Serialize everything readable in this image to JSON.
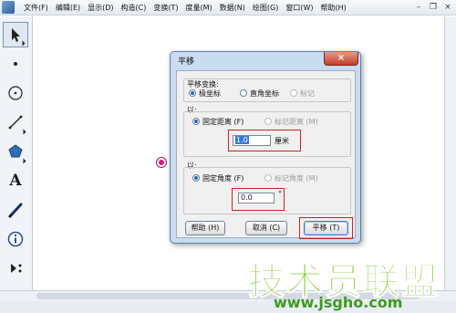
{
  "menubar": {
    "items": [
      "文件(F)",
      "编辑(E)",
      "显示(D)",
      "构造(C)",
      "变换(T)",
      "度量(M)",
      "数据(N)",
      "绘图(G)",
      "窗口(W)",
      "帮助(H)"
    ],
    "minimize": "–",
    "restore": "❐",
    "close": "×"
  },
  "toolbar": {
    "tools": [
      "select-arrow-icon",
      "point-icon",
      "compass-icon",
      "line-icon",
      "polygon-icon",
      "text-icon",
      "marker-icon",
      "info-icon",
      "custom-tool-icon"
    ],
    "text_tool_glyph": "A"
  },
  "dialog": {
    "title": "平移",
    "close_glyph": "×",
    "translation_type": {
      "label": "平移变换:",
      "options": [
        "极坐标",
        "直角坐标",
        "标记"
      ],
      "selected": "极坐标"
    },
    "distance": {
      "group_label": "以:",
      "fixed_label": "固定距离 (F)",
      "marked_label": "标记距离 (M)",
      "value": "1.0",
      "unit": "厘米"
    },
    "angle": {
      "group_label": "以:",
      "fixed_label": "固定角度 (F)",
      "marked_label": "标记角度 (M)",
      "value": "0.0",
      "unit": "°"
    },
    "buttons": {
      "help": "帮助 (H)",
      "cancel": "取消 (C)",
      "translate": "平移 (T)"
    }
  },
  "watermark": {
    "text": "技术员联盟",
    "url": "www.jsgho.com"
  },
  "colors": {
    "point_marker": "#e0177a",
    "highlight_box": "#d02020",
    "watermark_green": "#7fc020"
  }
}
